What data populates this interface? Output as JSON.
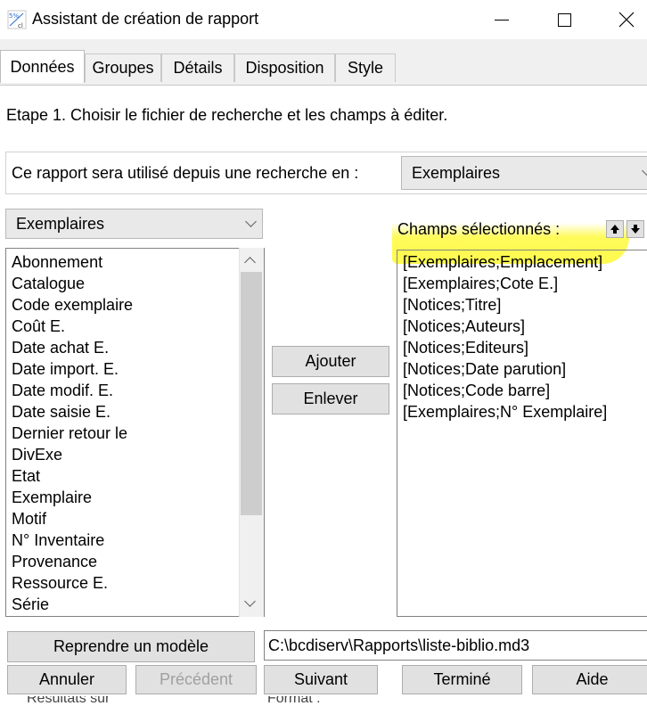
{
  "window": {
    "title": "Assistant de création de rapport",
    "icon": "report-wizard-icon"
  },
  "tabs": [
    {
      "label": "Données",
      "active": true
    },
    {
      "label": "Groupes"
    },
    {
      "label": "Détails"
    },
    {
      "label": "Disposition"
    },
    {
      "label": "Style"
    }
  ],
  "step": "Etape 1. Choisir le fichier de recherche et les champs à éditer.",
  "usage": {
    "label": "Ce rapport sera utilisé depuis une recherche en :",
    "value": "Exemplaires"
  },
  "table_select": {
    "value": "Exemplaires"
  },
  "fields": [
    "Abonnement",
    "Catalogue",
    "Code exemplaire",
    "Coût E.",
    "Date achat E.",
    "Date import. E.",
    "Date modif. E.",
    "Date saisie E.",
    "Dernier retour le",
    "DivExe",
    "Etat",
    "Exemplaire",
    "Motif",
    "N° Inventaire",
    "Provenance",
    "Ressource E.",
    "Série"
  ],
  "buttons": {
    "add": "Ajouter",
    "remove": "Enlever",
    "model": "Reprendre un modèle",
    "cancel": "Annuler",
    "previous": "Précédent",
    "next": "Suivant",
    "finish": "Terminé",
    "help": "Aide"
  },
  "selected": {
    "label": "Champs sélectionnés :",
    "items": [
      "[Exemplaires;Emplacement]",
      "[Exemplaires;Cote E.]",
      "[Notices;Titre]",
      "[Notices;Auteurs]",
      "[Notices;Editeurs]",
      "[Notices;Date parution]",
      "[Notices;Code barre]",
      "[Exemplaires;N° Exemplaire]"
    ]
  },
  "model_path": "C:\\bcdiserv\\Rapports\\liste-biblio.md3",
  "cutoff": {
    "left": "Résultats sur",
    "right": "Format :"
  },
  "colors": {
    "highlight": "#fffa3c",
    "button_bg": "#e1e1e1",
    "disabled_text": "#a0a0a0"
  }
}
